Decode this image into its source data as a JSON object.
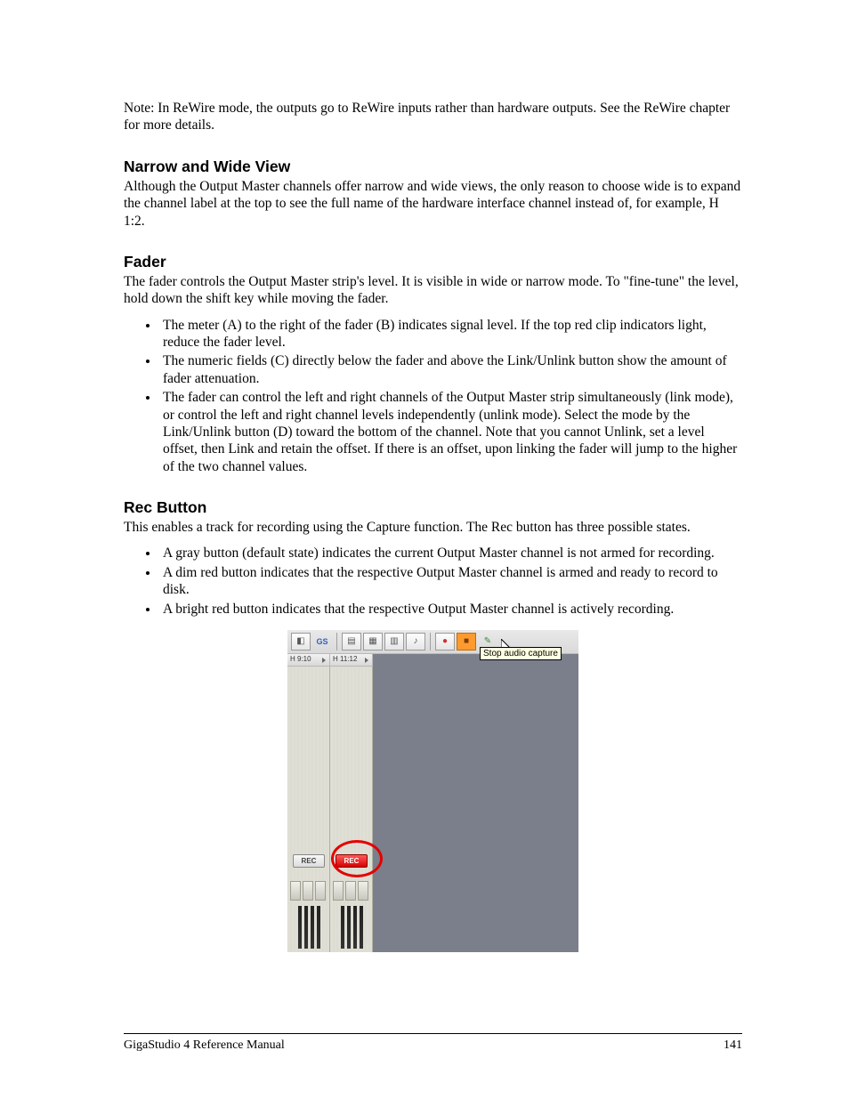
{
  "note": "Note: In ReWire mode, the outputs go to ReWire inputs rather than hardware outputs. See the ReWire chapter for more details.",
  "sections": {
    "narrow_wide": {
      "heading": "Narrow and Wide View",
      "body": "Although the Output Master channels offer narrow and wide views, the only reason to choose wide is to expand the channel label at the top to see the full name of the hardware interface channel instead of, for example, H 1:2."
    },
    "fader": {
      "heading": "Fader",
      "body": "The fader controls the Output Master strip's level. It is visible in wide or narrow mode. To \"fine-tune\" the level, hold down the shift key while moving the fader.",
      "bullets": [
        "The meter (A) to the right of the fader (B) indicates signal level. If the top red clip indicators light, reduce the fader level.",
        "The numeric fields (C) directly below the fader and above the Link/Unlink button show the amount of fader attenuation.",
        "The fader can control the left and right channels of the Output Master strip simultaneously (link mode), or control the left and right channel levels independently (unlink mode). Select the mode by the Link/Unlink button (D) toward the bottom of the channel. Note that you cannot Unlink, set a level offset, then Link and retain the offset. If there is an offset, upon linking the fader will jump to the higher of the two channel values."
      ]
    },
    "rec": {
      "heading": "Rec Button",
      "body": "This enables a track for recording using the Capture function. The Rec button has three possible states.",
      "bullets": [
        "A gray button (default state) indicates the current Output Master channel is not armed for recording.",
        "A dim red button indicates that the respective Output Master channel is armed and ready to record to disk.",
        "A bright red button indicates that the respective Output Master channel is actively recording."
      ]
    }
  },
  "screenshot": {
    "channels": [
      "H 9:10",
      "H 11:12"
    ],
    "rec_labels": [
      "REC",
      "REC"
    ],
    "tooltip": "Stop audio capture",
    "toolbar_icons": [
      "app-icon",
      "gs-icon",
      "view1-icon",
      "view2-icon",
      "view3-icon",
      "piano-icon",
      "record-icon",
      "stop-capture-icon",
      "disk-icon"
    ]
  },
  "footer": {
    "title": "GigaStudio 4 Reference Manual",
    "page": "141"
  }
}
